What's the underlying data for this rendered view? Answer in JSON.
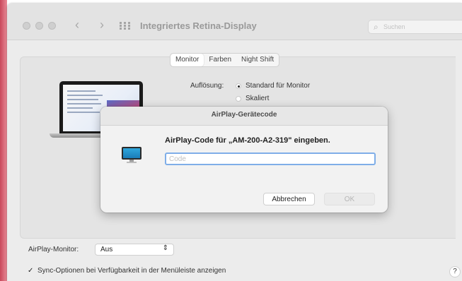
{
  "window": {
    "title": "Integriertes Retina-Display",
    "search": {
      "icon": "search-icon",
      "placeholder": "Suchen"
    },
    "nav": {
      "back_icon": "chevron-left-icon",
      "forward_icon": "chevron-right-icon",
      "grid_icon": "grid-icon"
    }
  },
  "tabs": [
    {
      "label": "Monitor",
      "active": true
    },
    {
      "label": "Farben",
      "active": false
    },
    {
      "label": "Night Shift",
      "active": false
    }
  ],
  "resolution": {
    "label": "Auflösung:",
    "options": [
      {
        "label": "Standard für Monitor",
        "selected": true
      },
      {
        "label": "Skaliert",
        "selected": false
      }
    ]
  },
  "dialog": {
    "title": "AirPlay-Gerätecode",
    "icon": "display-icon",
    "prompt": "AirPlay-Code für „AM-200-A2-319\" eingeben.",
    "input": {
      "value": "",
      "placeholder": "Code"
    },
    "cancel_label": "Abbrechen",
    "ok_label": "OK"
  },
  "footer": {
    "airplay_label": "AirPlay-Monitor:",
    "airplay_value": "Aus",
    "sync_checked": true,
    "sync_label": "Sync-Optionen bei Verfügbarkeit in der Menüleiste anzeigen",
    "help_label": "?"
  },
  "colors": {
    "accent_focus": "#7faee8",
    "left_accent": "#c9485b"
  }
}
